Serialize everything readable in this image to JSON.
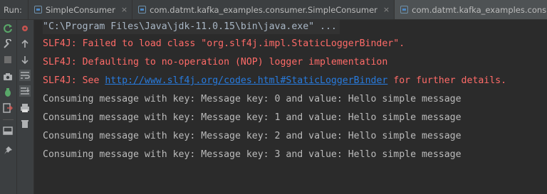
{
  "run_bar": {
    "label": "Run:",
    "tabs": [
      {
        "label": "SimpleConsumer",
        "close": "×"
      },
      {
        "label": "com.datmt.kafka_examples.consumer.SimpleConsumer",
        "close": "×"
      },
      {
        "label": "com.datmt.kafka_examples.consumer.SimpleConsumer",
        "close": "×"
      }
    ]
  },
  "toolbar": {
    "rerun_icon": "rerun-icon",
    "stop_icon": "stop-icon",
    "up_icon": "up-arrow-icon",
    "down_icon": "down-arrow-icon",
    "wrap_icon": "soft-wrap-icon",
    "scroll_end_icon": "scroll-to-end-icon",
    "print_icon": "print-icon",
    "delete_icon": "trash-icon"
  },
  "console": {
    "command": "\"C:\\Program Files\\Java\\jdk-11.0.15\\bin\\java.exe\" ...",
    "err1": "SLF4J: Failed to load class \"org.slf4j.impl.StaticLoggerBinder\".",
    "err2": "SLF4J: Defaulting to no-operation (NOP) logger implementation",
    "err3_prefix": "SLF4J: See ",
    "err3_link": "http://www.slf4j.org/codes.html#StaticLoggerBinder",
    "err3_suffix": " for further details.",
    "messages": [
      "Consuming message with key: Message key: 0 and value: Hello simple message",
      "Consuming message with key: Message key: 1 and value: Hello simple message",
      "Consuming message with key: Message key: 2 and value: Hello simple message",
      "Consuming message with key: Message key: 3 and value: Hello simple message"
    ]
  },
  "colors": {
    "error": "#ff6b68",
    "output": "#bbbbbb",
    "link": "#287bde",
    "background": "#2b2b2b"
  }
}
